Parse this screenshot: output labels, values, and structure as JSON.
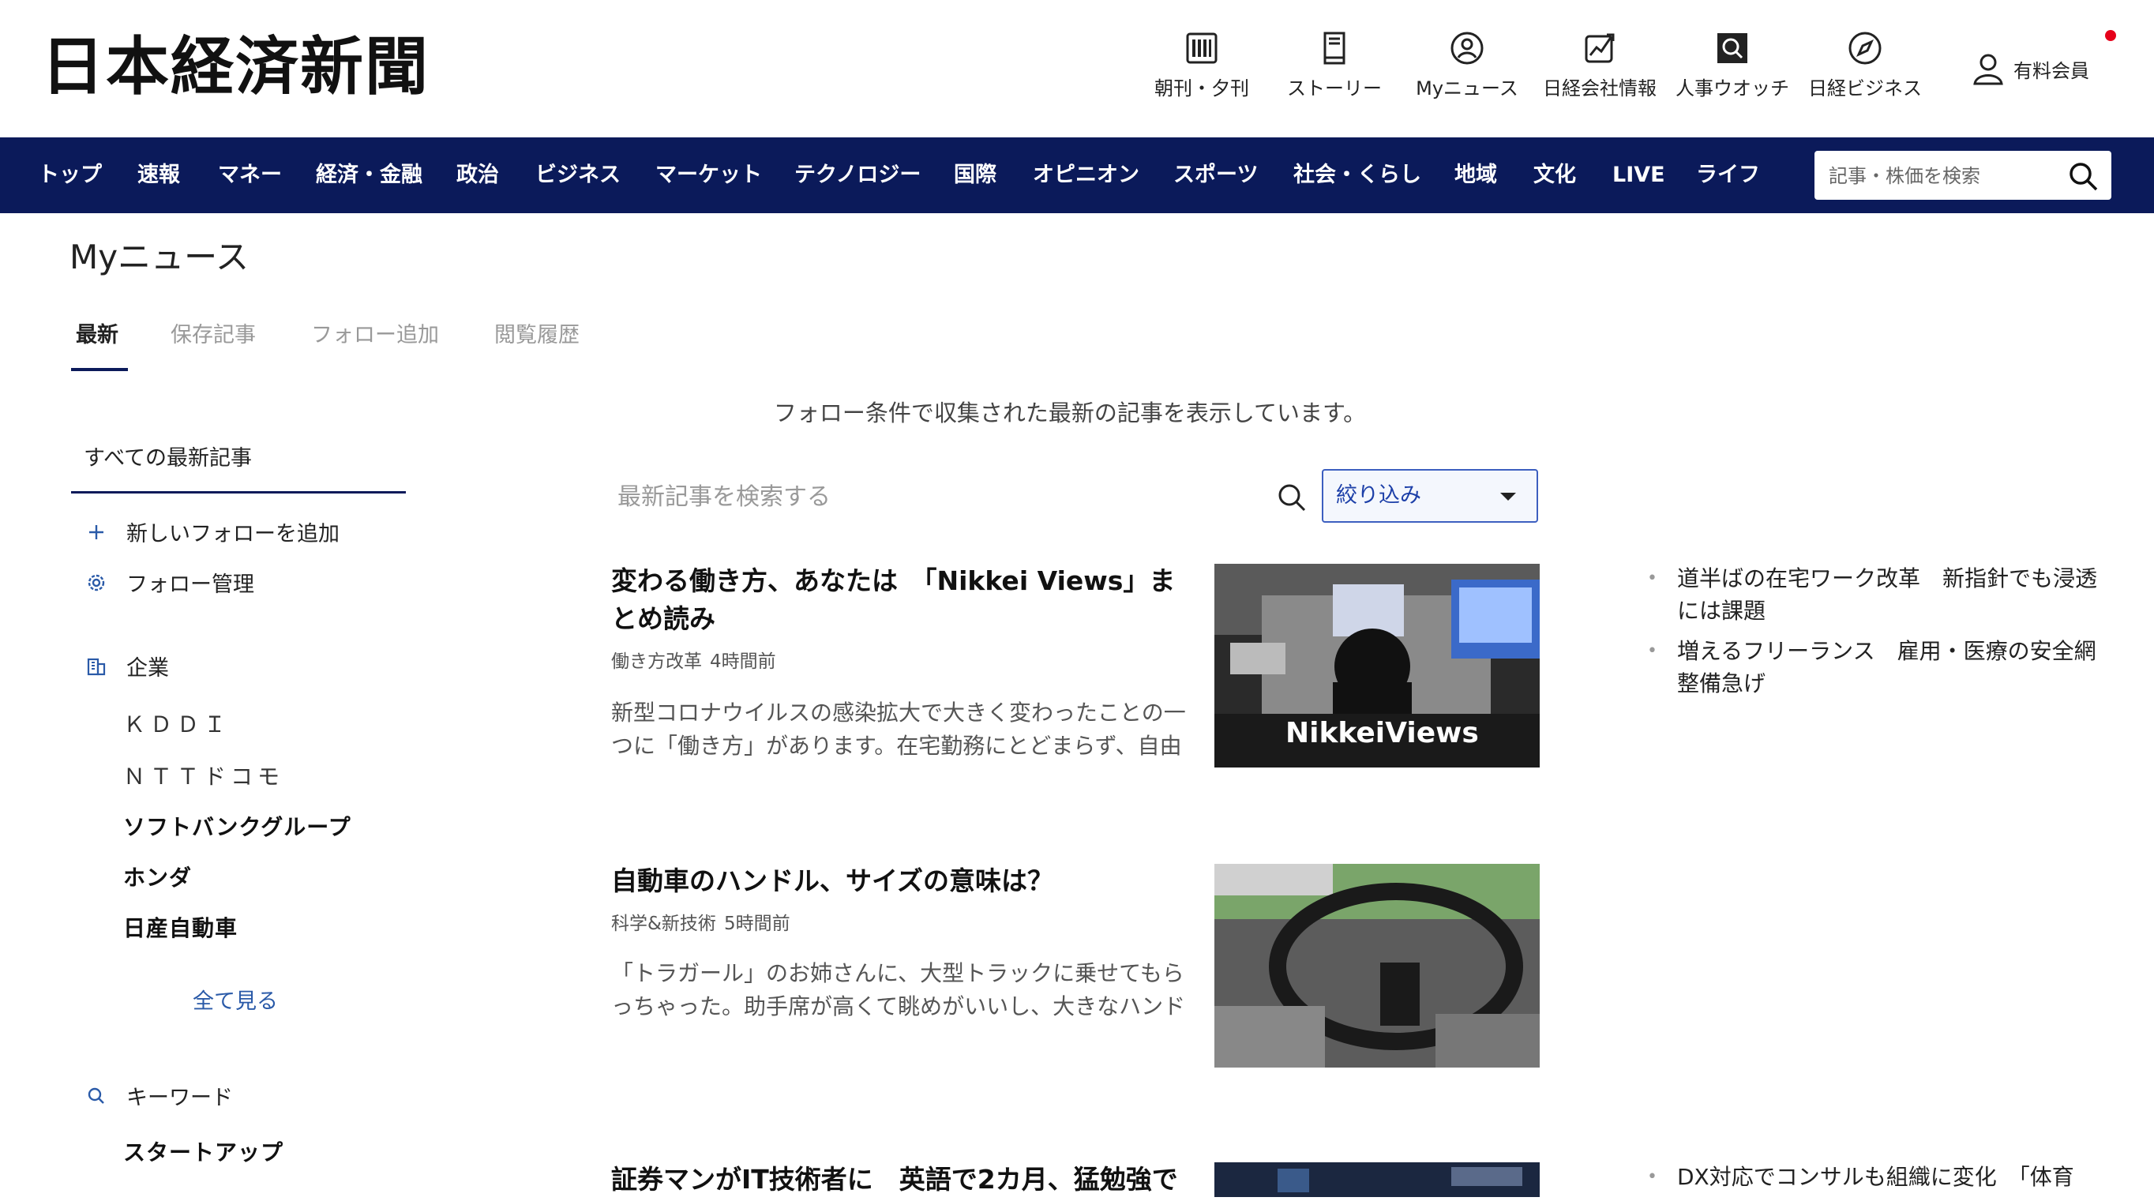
{
  "header": {
    "logo": "日本経済新聞",
    "tools": [
      {
        "label": "朝刊・夕刊",
        "icon": "newspaper-icon"
      },
      {
        "label": "ストーリー",
        "icon": "book-icon"
      },
      {
        "label": "Myニュース",
        "icon": "user-circle-icon"
      },
      {
        "label": "日経会社情報",
        "icon": "chart-icon"
      },
      {
        "label": "人事ウオッチ",
        "icon": "search-square-icon"
      },
      {
        "label": "日経ビジネス",
        "icon": "compass-icon"
      }
    ],
    "member_label": "有料会員",
    "notification_color": "#e6001a"
  },
  "nav": {
    "items": [
      "トップ",
      "速報",
      "マネー",
      "経済・金融",
      "政治",
      "ビジネス",
      "マーケット",
      "テクノロジー",
      "国際",
      "オピニオン",
      "スポーツ",
      "社会・くらし",
      "地域",
      "文化",
      "LIVE",
      "ライフ"
    ],
    "search_placeholder": "記事・株価を検索",
    "bg_color": "#0b1a5a"
  },
  "page": {
    "title": "Myニュース",
    "tabs": [
      "最新",
      "保存記事",
      "フォロー追加",
      "閲覧履歴"
    ],
    "active_tab": "最新"
  },
  "sidebar": {
    "all_label": "すべての最新記事",
    "add_follow": "新しいフォローを追加",
    "manage_follow": "フォロー管理",
    "companies_heading": "企業",
    "companies": [
      "ＫＤＤＩ",
      "ＮＴＴドコモ",
      "ソフトバンクグループ",
      "ホンダ",
      "日産自動車"
    ],
    "see_all": "全て見る",
    "keywords_heading": "キーワード",
    "keywords": [
      "スタートアップ"
    ]
  },
  "main": {
    "intro": "フォロー条件で収集された最新の記事を表示しています。",
    "search_placeholder": "最新記事を検索する",
    "filter_label": "絞り込み",
    "articles": [
      {
        "title": "変わる働き方、あなたは　「Nikkei Views」まとめ読み",
        "tag": "働き方改革",
        "time": "4時間前",
        "snippet": "新型コロナウイルスの感染拡大で大きく変わったことの一つに「働き方」があります。在宅勤務にとどまらず、自由",
        "image_caption": "NikkeiViews"
      },
      {
        "title": "自動車のハンドル、サイズの意味は？",
        "tag": "科学&新技術",
        "time": "5時間前",
        "snippet": "「トラガール」のお姉さんに、大型トラックに乗せてもらっちゃった。助手席が高くて眺めがいいし、大きなハンド"
      },
      {
        "title": "証券マンがIT技術者に　英語で2カ月、猛勉強で"
      }
    ]
  },
  "rail": {
    "group1": [
      "道半ばの在宅ワーク改革　新指針でも浸透には課題",
      "増えるフリーランス　雇用・医療の安全網整備急げ"
    ],
    "group2": [
      "DX対応でコンサルも組織に変化　「体育"
    ]
  }
}
